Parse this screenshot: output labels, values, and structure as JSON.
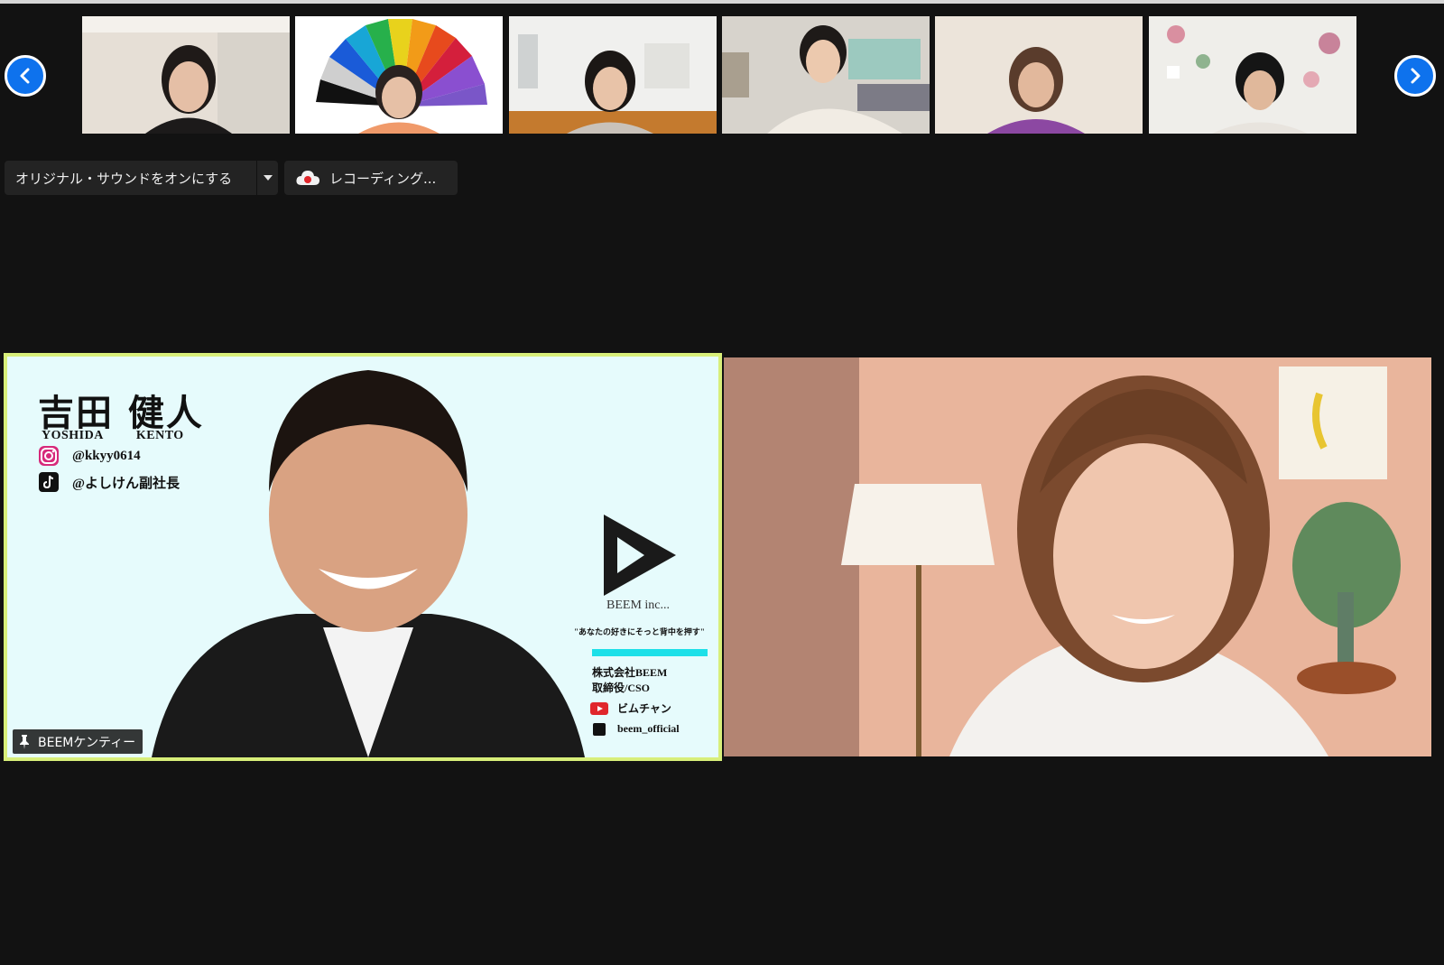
{
  "navigation": {
    "prev_icon": "chevron-left-icon",
    "next_icon": "chevron-right-icon"
  },
  "gallery": {
    "participants": [
      {
        "id": "participant-1",
        "backdrop": "#e8e2da"
      },
      {
        "id": "participant-2",
        "backdrop": "#ffffff"
      },
      {
        "id": "participant-3",
        "backdrop": "#f2f2f0"
      },
      {
        "id": "participant-4",
        "backdrop": "#d9d6cf"
      },
      {
        "id": "participant-5",
        "backdrop": "#ebe3d9"
      },
      {
        "id": "participant-6",
        "backdrop": "#efeeea"
      }
    ]
  },
  "toolbar": {
    "original_sound_label": "オリジナル・サウンドをオンにする",
    "recording_label": "レコーディング..."
  },
  "speaker": {
    "card": {
      "name_kanji": "吉田 健人",
      "name_first_roman": "YOSHIDA",
      "name_last_roman": "KENTO",
      "instagram_handle": "@kkyy0614",
      "tiktok_handle": "@よしけん副社長",
      "brand_name": "BEEM inc...",
      "slogan": "\"あなたの好きにそっと背中を押す\"",
      "company": "株式会社BEEM",
      "title": "取締役/CSO",
      "youtube_channel": "ビムチャン",
      "tiktok_official": "beem_official"
    },
    "display_name": "BEEMケンティー",
    "highlight_color": "#d8ef7a"
  },
  "colors": {
    "background": "#121212",
    "accent": "#0e72ed",
    "record_red": "#e0262b"
  }
}
